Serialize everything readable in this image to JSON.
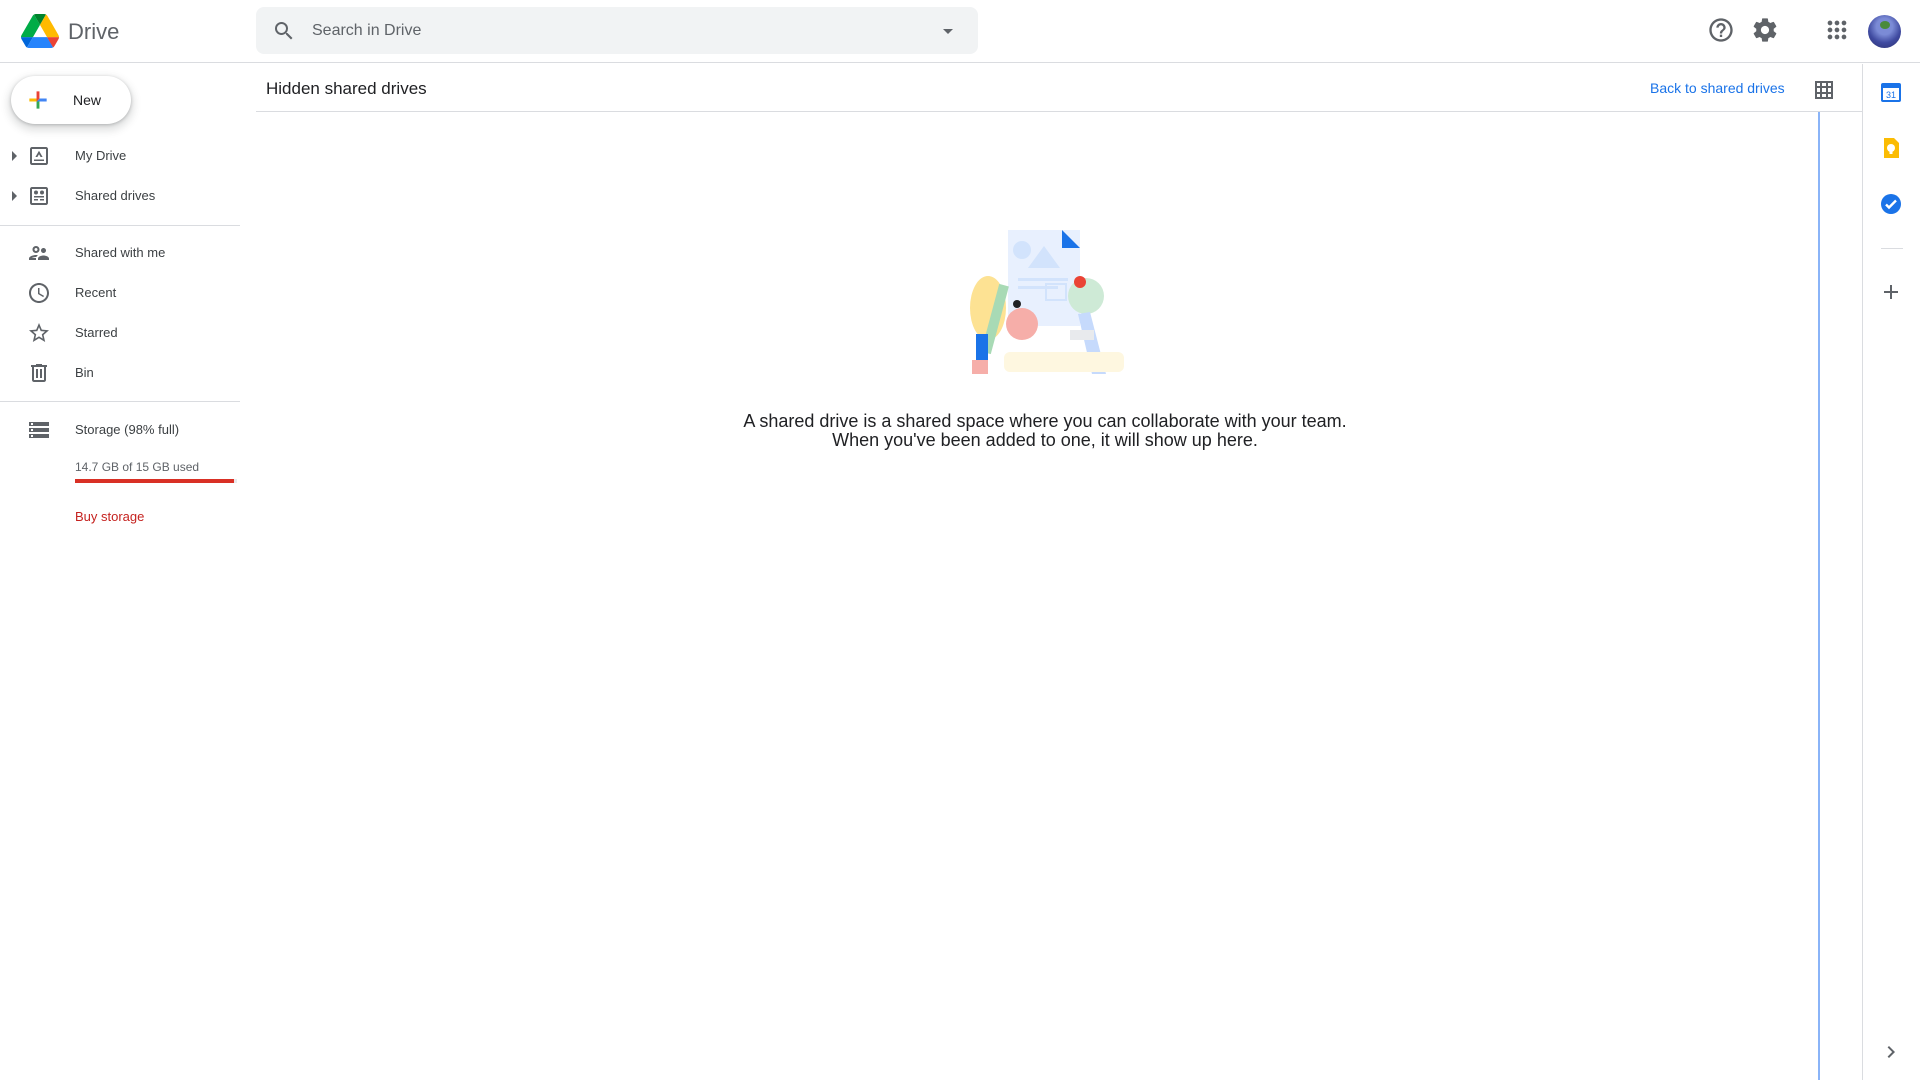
{
  "app": {
    "name": "Drive"
  },
  "search": {
    "placeholder": "Search in Drive",
    "value": ""
  },
  "header": {
    "icons": [
      "help-icon",
      "settings-icon",
      "apps-icon",
      "account-avatar"
    ]
  },
  "sidebar": {
    "new_label": "New",
    "items": [
      {
        "label": "My Drive",
        "icon": "my-drive-icon",
        "expandable": true
      },
      {
        "label": "Shared drives",
        "icon": "shared-drives-icon",
        "expandable": true
      },
      {
        "label": "Shared with me",
        "icon": "people-icon"
      },
      {
        "label": "Recent",
        "icon": "clock-icon"
      },
      {
        "label": "Starred",
        "icon": "star-icon"
      },
      {
        "label": "Bin",
        "icon": "trash-icon"
      },
      {
        "label": "Storage (98% full)",
        "icon": "storage-icon"
      }
    ],
    "storage": {
      "used_text": "14.7 GB of 15 GB used",
      "fraction_used": 0.98
    },
    "buy_storage": "Buy storage"
  },
  "main": {
    "title": "Hidden shared drives",
    "back_link": "Back to shared drives",
    "empty_message": "A shared drive is a shared space where you can collaborate with your team. When you've been added to one, it will show up here."
  },
  "side_panel": {
    "icons": [
      "calendar-icon",
      "keep-icon",
      "tasks-icon",
      "add-icon",
      "chevron-right-icon"
    ],
    "calendar_day": "31"
  },
  "colors": {
    "accent": "#1a73e8",
    "storage_warning": "#d93025",
    "buy_storage": "#c5221f"
  }
}
